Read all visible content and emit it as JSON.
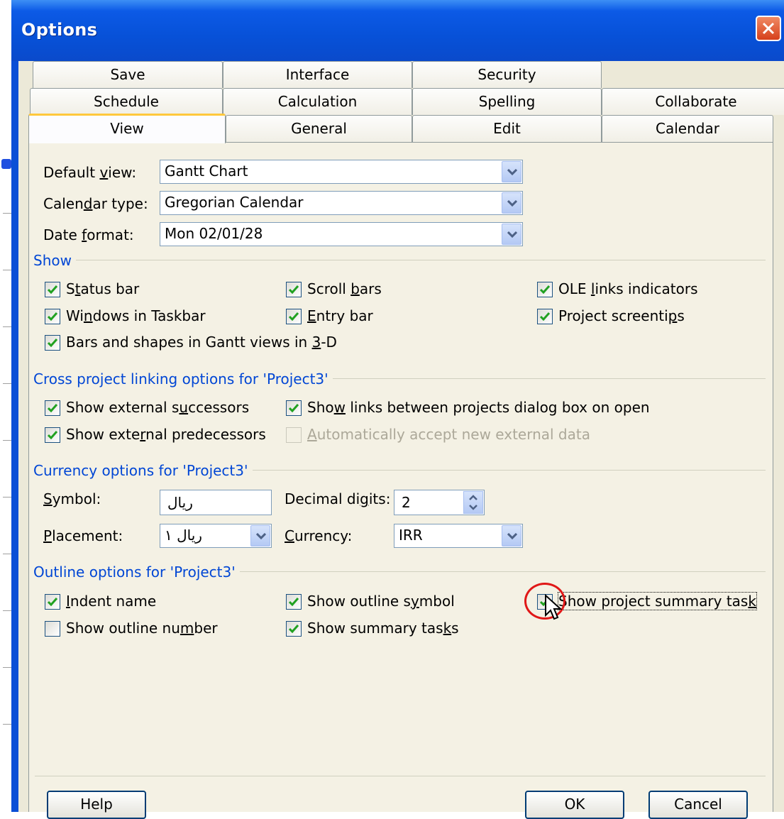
{
  "window": {
    "title": "Options"
  },
  "tabs": {
    "row1": [
      "Save",
      "Interface",
      "Security"
    ],
    "row2": [
      "Schedule",
      "Calculation",
      "Spelling",
      "Collaborate"
    ],
    "row3": [
      "View",
      "General",
      "Edit",
      "Calendar"
    ],
    "active": "View"
  },
  "view": {
    "default_view": {
      "label_pre": "Default ",
      "label_u": "v",
      "label_post": "iew:",
      "value": "Gantt Chart"
    },
    "calendar_type": {
      "label_pre": "Calen",
      "label_u": "d",
      "label_post": "ar type:",
      "value": "Gregorian Calendar"
    },
    "date_format": {
      "label_pre": "Date ",
      "label_u": "f",
      "label_post": "ormat:",
      "value": "Mon 02/01/28"
    }
  },
  "show_group": {
    "title": "Show",
    "items": [
      {
        "pre": "S",
        "u": "t",
        "post": "atus bar",
        "checked": true
      },
      {
        "pre": "Scroll ",
        "u": "b",
        "post": "ars",
        "checked": true
      },
      {
        "pre": "OLE ",
        "u": "l",
        "post": "inks indicators",
        "checked": true
      },
      {
        "pre": "Wi",
        "u": "n",
        "post": "dows in Taskbar",
        "checked": true
      },
      {
        "pre": "",
        "u": "E",
        "post": "ntry bar",
        "checked": true
      },
      {
        "pre": "Project screenti",
        "u": "p",
        "post": "s",
        "checked": true
      },
      {
        "pre": "Bars and shapes in Gantt views in ",
        "u": "3",
        "post": "-D",
        "checked": true
      }
    ]
  },
  "cross_group": {
    "title": "Cross project linking options for 'Project3'",
    "items": [
      {
        "pre": "Show external s",
        "u": "u",
        "post": "ccessors",
        "checked": true,
        "enabled": true
      },
      {
        "pre": "Sho",
        "u": "w",
        "post": " links between projects dialog box on open",
        "checked": true,
        "enabled": true
      },
      {
        "pre": "Show exte",
        "u": "r",
        "post": "nal predecessors",
        "checked": true,
        "enabled": true
      },
      {
        "pre": "",
        "u": "A",
        "post": "utomatically accept new external data",
        "checked": false,
        "enabled": false
      }
    ]
  },
  "currency_group": {
    "title": "Currency options for 'Project3'",
    "symbol": {
      "label_pre": "",
      "label_u": "S",
      "label_post": "ymbol:",
      "value": "ریال"
    },
    "placement": {
      "label_pre": "",
      "label_u": "P",
      "label_post": "lacement:",
      "value": "ریال ۱"
    },
    "decimal": {
      "label_pre": "Decimal di",
      "label_u": "g",
      "label_post": "its:",
      "value": "2"
    },
    "currency": {
      "label_pre": "",
      "label_u": "C",
      "label_post": "urrency:",
      "value": "IRR"
    }
  },
  "outline_group": {
    "title": "Outline options for 'Project3'",
    "items": [
      {
        "pre": "",
        "u": "I",
        "post": "ndent name",
        "checked": true
      },
      {
        "pre": "Show outline s",
        "u": "y",
        "post": "mbol",
        "checked": true
      },
      {
        "pre": "Show project summary tas",
        "u": "k",
        "post": "",
        "checked": true
      },
      {
        "pre": "Show outline nu",
        "u": "m",
        "post": "ber",
        "checked": false
      },
      {
        "pre": "Show summary tas",
        "u": "k",
        "post": "s",
        "checked": true
      }
    ]
  },
  "buttons": {
    "help": "Help",
    "ok": "OK",
    "cancel": "Cancel"
  },
  "colors": {
    "title_blue": "#0a4fd6",
    "dialog_bg": "#ece9d8",
    "group_title": "#0046d5",
    "highlight": "#e01818"
  }
}
